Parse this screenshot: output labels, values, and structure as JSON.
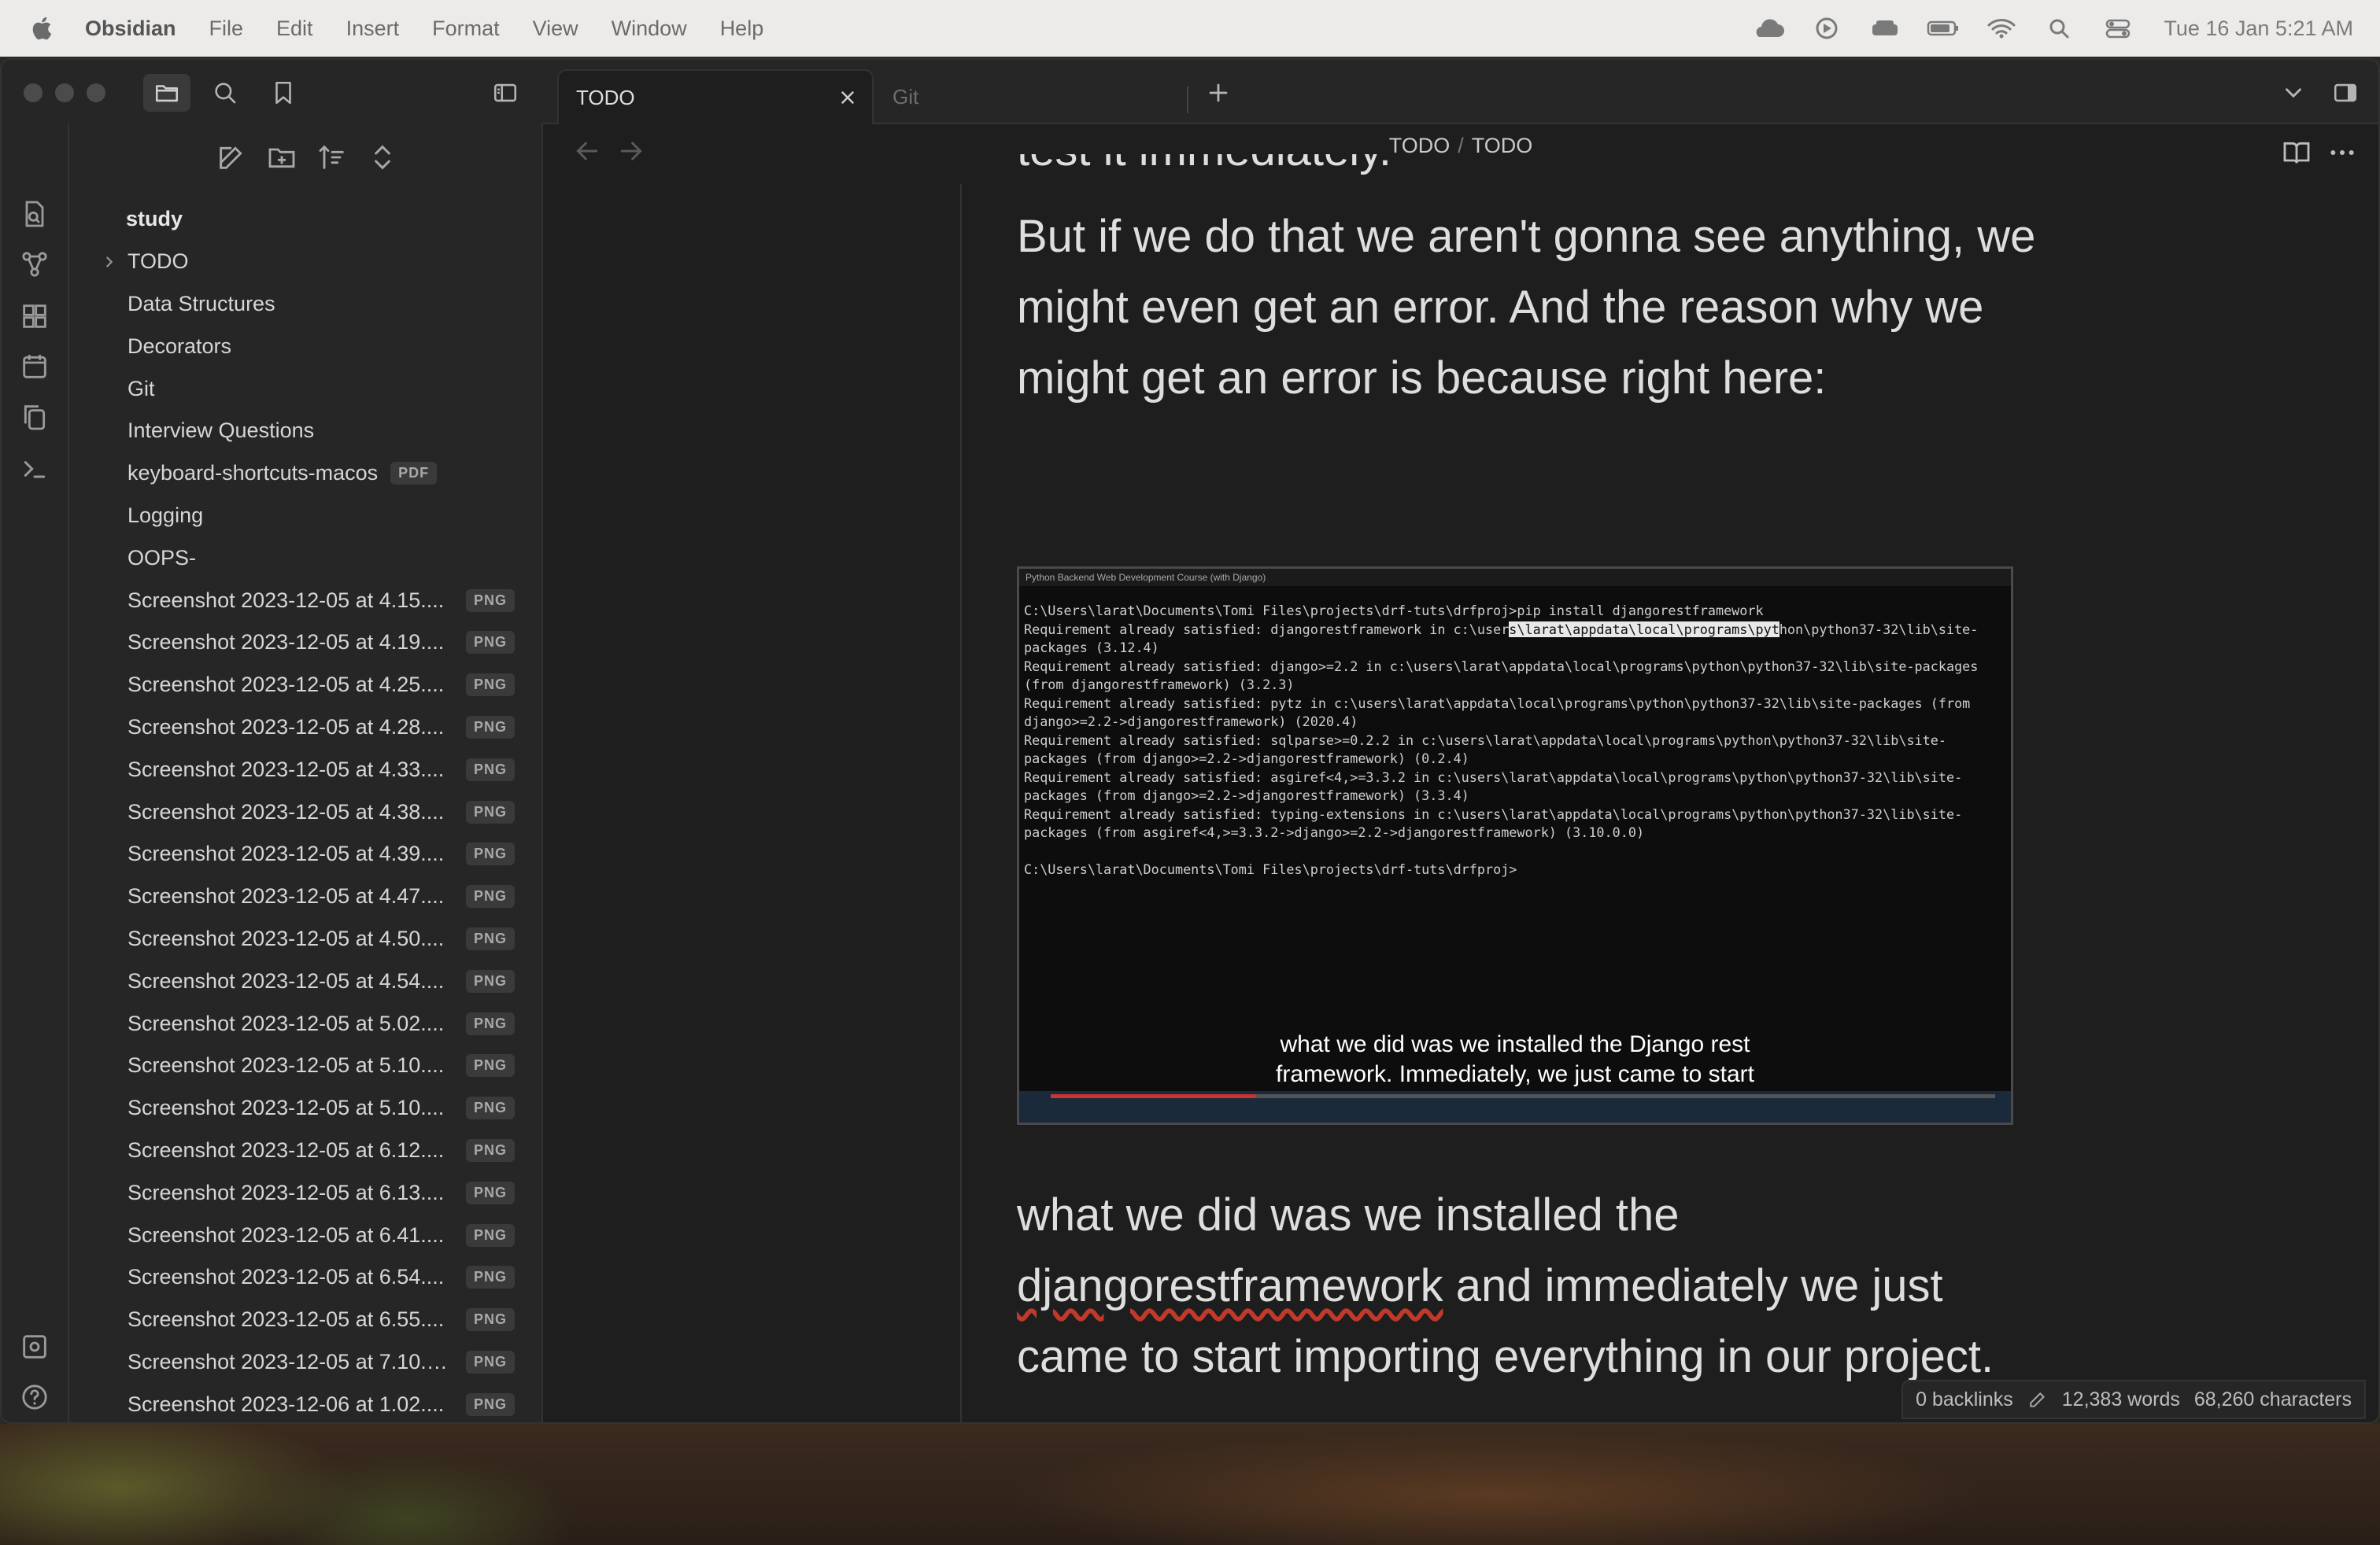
{
  "menubar": {
    "app": "Obsidian",
    "items": [
      "File",
      "Edit",
      "Insert",
      "Format",
      "View",
      "Window",
      "Help"
    ],
    "clock": "Tue 16 Jan  5:21 AM"
  },
  "tabs": [
    {
      "label": "TODO"
    },
    {
      "label": "Git"
    }
  ],
  "breadcrumb": {
    "folder": "TODO",
    "separator": "/",
    "file": "TODO"
  },
  "tree": {
    "root": "study",
    "folder": "TODO",
    "items": [
      {
        "label": "Data Structures"
      },
      {
        "label": "Decorators"
      },
      {
        "label": "Git"
      },
      {
        "label": "Interview Questions"
      },
      {
        "label": "keyboard-shortcuts-macos",
        "badge": "PDF"
      },
      {
        "label": "Logging"
      },
      {
        "label": "OOPS-"
      },
      {
        "label": "Screenshot 2023-12-05 at 4.15....",
        "badge": "PNG"
      },
      {
        "label": "Screenshot 2023-12-05 at 4.19....",
        "badge": "PNG"
      },
      {
        "label": "Screenshot 2023-12-05 at 4.25....",
        "badge": "PNG"
      },
      {
        "label": "Screenshot 2023-12-05 at 4.28....",
        "badge": "PNG"
      },
      {
        "label": "Screenshot 2023-12-05 at 4.33....",
        "badge": "PNG"
      },
      {
        "label": "Screenshot 2023-12-05 at 4.38....",
        "badge": "PNG"
      },
      {
        "label": "Screenshot 2023-12-05 at 4.39....",
        "badge": "PNG"
      },
      {
        "label": "Screenshot 2023-12-05 at 4.47....",
        "badge": "PNG"
      },
      {
        "label": "Screenshot 2023-12-05 at 4.50....",
        "badge": "PNG"
      },
      {
        "label": "Screenshot 2023-12-05 at 4.54....",
        "badge": "PNG"
      },
      {
        "label": "Screenshot 2023-12-05 at 5.02....",
        "badge": "PNG"
      },
      {
        "label": "Screenshot 2023-12-05 at 5.10....",
        "badge": "PNG"
      },
      {
        "label": "Screenshot 2023-12-05 at 5.10....",
        "badge": "PNG"
      },
      {
        "label": "Screenshot 2023-12-05 at 6.12....",
        "badge": "PNG"
      },
      {
        "label": "Screenshot 2023-12-05 at 6.13....",
        "badge": "PNG"
      },
      {
        "label": "Screenshot 2023-12-05 at 6.41....",
        "badge": "PNG"
      },
      {
        "label": "Screenshot 2023-12-05 at 6.54....",
        "badge": "PNG"
      },
      {
        "label": "Screenshot 2023-12-05 at 6.55....",
        "badge": "PNG"
      },
      {
        "label": "Screenshot 2023-12-05 at 7.10.1...",
        "badge": "PNG"
      },
      {
        "label": "Screenshot 2023-12-06 at 1.02....",
        "badge": "PNG"
      }
    ]
  },
  "editor": {
    "cut_line": "test it immediately.",
    "para1": "But if we do that we aren't gonna see anything, we might even get an error. And the reason why we might get an error is because right here:",
    "para2_before": "what we did was we installed the ",
    "para2_misspelled": "djangorestframework",
    "para2_after": " and immediately we just came to start importing everything in our project."
  },
  "embed": {
    "window_title": "Python Backend Web Development Course (with Django)",
    "line1": "C:\\Users\\larat\\Documents\\Tomi Files\\projects\\drf-tuts\\drfproj>pip install djangorestframework",
    "line2a": "Requirement already satisfied: djangorestframework in c:\\user",
    "line2hl": "s\\larat\\appdata\\local\\programs\\pyt",
    "line2b": "hon\\python37-32\\lib\\site-packages (3.12.4)",
    "rest": "Requirement already satisfied: django>=2.2 in c:\\users\\larat\\appdata\\local\\programs\\python\\python37-32\\lib\\site-packages (from djangorestframework) (3.2.3)\nRequirement already satisfied: pytz in c:\\users\\larat\\appdata\\local\\programs\\python\\python37-32\\lib\\site-packages (from django>=2.2->djangorestframework) (2020.4)\nRequirement already satisfied: sqlparse>=0.2.2 in c:\\users\\larat\\appdata\\local\\programs\\python\\python37-32\\lib\\site-packages (from django>=2.2->djangorestframework) (0.2.4)\nRequirement already satisfied: asgiref<4,>=3.3.2 in c:\\users\\larat\\appdata\\local\\programs\\python\\python37-32\\lib\\site-packages (from django>=2.2->djangorestframework) (3.3.4)\nRequirement already satisfied: typing-extensions in c:\\users\\larat\\appdata\\local\\programs\\python\\python37-32\\lib\\site-packages (from asgiref<4,>=3.3.2->django>=2.2->djangorestframework) (3.10.0.0)\n\nC:\\Users\\larat\\Documents\\Tomi Files\\projects\\drf-tuts\\drfproj>",
    "caption_line1": "what we did was we installed the Django rest",
    "caption_line2": "framework. Immediately, we just came to start"
  },
  "status": {
    "backlinks": "0 backlinks",
    "words": "12,383 words",
    "characters": "68,260 characters"
  }
}
